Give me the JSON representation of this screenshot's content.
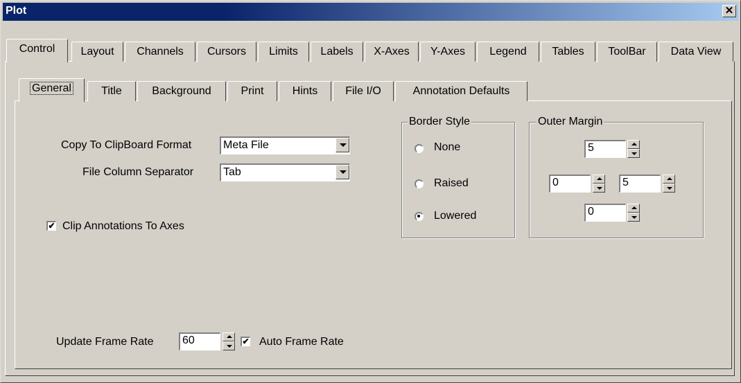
{
  "window": {
    "title": "Plot",
    "close_glyph": "✕"
  },
  "main_tabs": [
    {
      "label": "Control"
    },
    {
      "label": "Layout"
    },
    {
      "label": "Channels"
    },
    {
      "label": "Cursors"
    },
    {
      "label": "Limits"
    },
    {
      "label": "Labels"
    },
    {
      "label": "X-Axes"
    },
    {
      "label": "Y-Axes"
    },
    {
      "label": "Legend"
    },
    {
      "label": "Tables"
    },
    {
      "label": "ToolBar"
    },
    {
      "label": "Data View"
    }
  ],
  "sub_tabs": [
    {
      "label": "General"
    },
    {
      "label": "Title"
    },
    {
      "label": "Background"
    },
    {
      "label": "Print"
    },
    {
      "label": "Hints"
    },
    {
      "label": "File I/O"
    },
    {
      "label": "Annotation Defaults"
    }
  ],
  "general": {
    "clipboard_label": "Copy To ClipBoard Format",
    "clipboard_value": "Meta File",
    "separator_label": "File Column Separator",
    "separator_value": "Tab",
    "clip_annotations_label": "Clip Annotations To Axes",
    "clip_annotations_checked": true,
    "frame_rate_label": "Update Frame Rate",
    "frame_rate_value": "60",
    "auto_frame_rate_label": "Auto Frame Rate",
    "auto_frame_rate_checked": true
  },
  "border_style": {
    "title": "Border Style",
    "options": [
      {
        "label": "None",
        "selected": false
      },
      {
        "label": "Raised",
        "selected": false
      },
      {
        "label": "Lowered",
        "selected": true
      }
    ]
  },
  "outer_margin": {
    "title": "Outer Margin",
    "top": "5",
    "left": "0",
    "right": "5",
    "bottom": "0"
  },
  "check_glyph": "✔"
}
